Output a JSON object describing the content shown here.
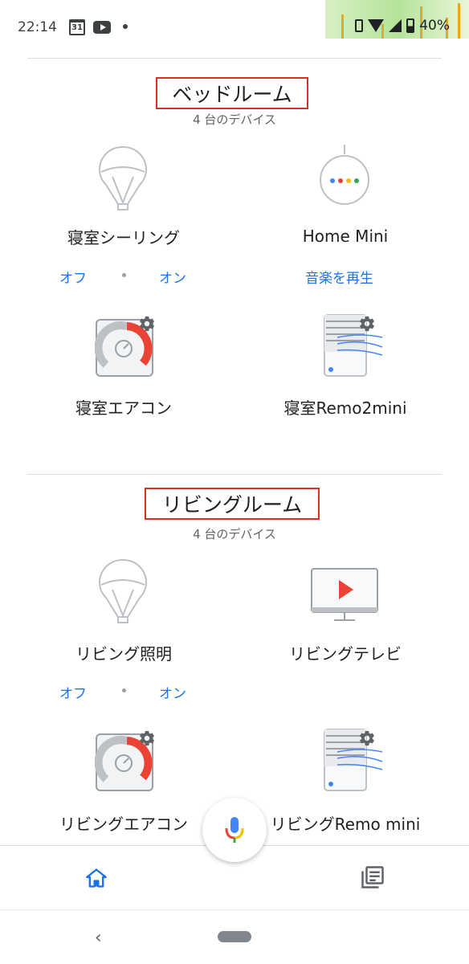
{
  "status_bar": {
    "time": "22:14",
    "calendar_day": "31",
    "battery": "40%",
    "icons": [
      "calendar-icon",
      "youtube-icon",
      "notification-dot-icon",
      "vibrate-icon",
      "wifi-icon",
      "signal-icon",
      "battery-icon"
    ]
  },
  "rooms": [
    {
      "title": "ベッドルーム",
      "subtitle": "4 台のデバイス",
      "devices": [
        {
          "name": "寝室シーリング",
          "icon": "light-bulb-icon",
          "actions": [
            "オフ",
            "オン"
          ]
        },
        {
          "name": "Home Mini",
          "icon": "smart-speaker-icon",
          "actions": [
            "音楽を再生"
          ]
        },
        {
          "name": "寝室エアコン",
          "icon": "thermostat-icon",
          "actions": []
        },
        {
          "name": "寝室Remo2mini",
          "icon": "remote-hub-icon",
          "actions": []
        }
      ]
    },
    {
      "title": "リビングルーム",
      "subtitle": "4 台のデバイス",
      "devices": [
        {
          "name": "リビング照明",
          "icon": "light-bulb-icon",
          "actions": [
            "オフ",
            "オン"
          ]
        },
        {
          "name": "リビングテレビ",
          "icon": "tv-icon",
          "actions": []
        },
        {
          "name": "リビングエアコン",
          "icon": "thermostat-icon",
          "actions": []
        },
        {
          "name": "リビングRemo mini",
          "icon": "remote-hub-icon",
          "actions": []
        }
      ]
    }
  ],
  "bottom_nav": {
    "items": [
      "home-icon",
      "feed-icon"
    ],
    "active": "home-icon",
    "fab": "microphone-icon"
  },
  "colors": {
    "accent": "#1a73e8",
    "highlight_box": "#d93025",
    "thermostat_red": "#ea4335",
    "tv_red": "#ea4335"
  }
}
